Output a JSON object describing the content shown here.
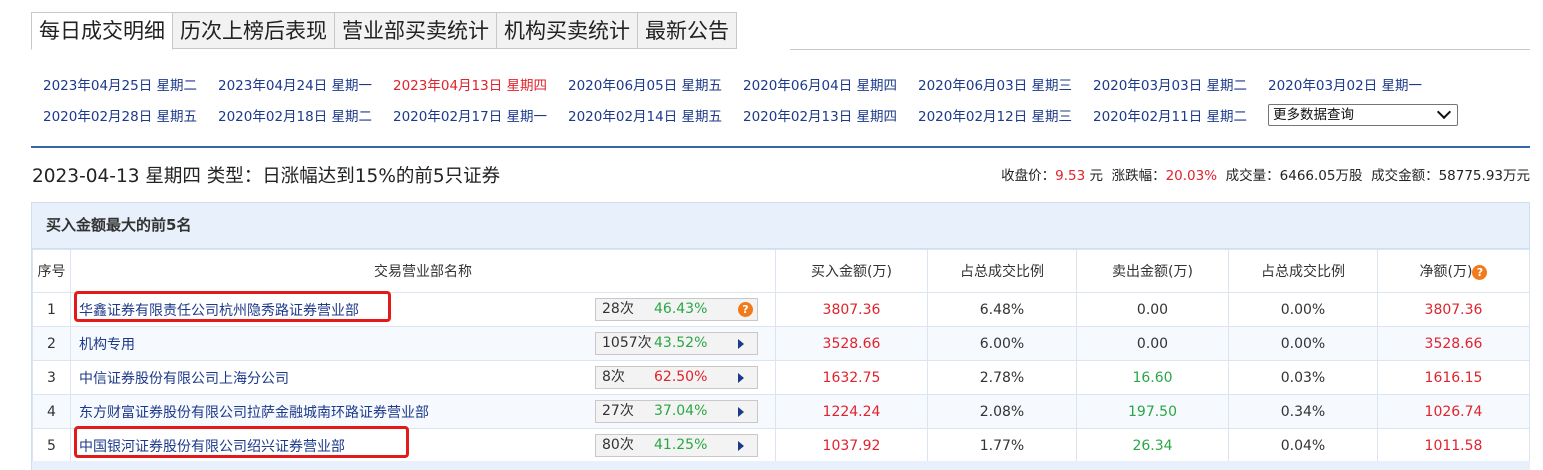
{
  "tabs": [
    {
      "label": "每日成交明细",
      "active": true
    },
    {
      "label": "历次上榜后表现",
      "active": false
    },
    {
      "label": "营业部买卖统计",
      "active": false
    },
    {
      "label": "机构买卖统计",
      "active": false
    },
    {
      "label": "最新公告",
      "active": false
    }
  ],
  "dates": [
    [
      "2023年04月25日 星期二",
      "2023年04月24日 星期一",
      "2023年04月13日 星期四",
      "2020年06月05日 星期五",
      "2020年06月04日 星期四",
      "2020年06月03日 星期三",
      "2020年03月03日 星期二",
      "2020年03月02日 星期一"
    ],
    [
      "2020年02月28日 星期五",
      "2020年02月18日 星期二",
      "2020年02月17日 星期一",
      "2020年02月14日 星期五",
      "2020年02月13日 星期四",
      "2020年02月12日 星期三",
      "2020年02月11日 星期二"
    ]
  ],
  "current_date": "2023年04月13日 星期四",
  "more_select": {
    "value": "更多数据查询"
  },
  "summary": {
    "title": "2023-04-13 星期四 类型：日涨幅达到15%的前5只证券",
    "close_label": "收盘价：",
    "close_value": "9.53",
    "close_unit": "元",
    "change_label": "涨跌幅：",
    "change_value": "20.03%",
    "volume_label": "成交量：",
    "volume_value": "6466.05万股",
    "amount_label": "成交金额：",
    "amount_value": "58775.93万元"
  },
  "table": {
    "caption": "买入金额最大的前5名",
    "headers": {
      "idx": "序号",
      "name": "交易营业部名称",
      "buy": "买入金额(万)",
      "buy_ratio": "占总成交比例",
      "sell": "卖出金额(万)",
      "sell_ratio": "占总成交比例",
      "net": "净额(万)"
    },
    "rows": [
      {
        "idx": "1",
        "name": "华鑫证券有限责任公司杭州隐秀路证券营业部",
        "count": "28次",
        "rate": "46.43%",
        "buy": "3807.36",
        "buy_ratio": "6.48%",
        "sell": "0.00",
        "sell_ratio": "0.00%",
        "net": "3807.36",
        "icon": "question-icon"
      },
      {
        "idx": "2",
        "name": "机构专用",
        "count": "1057次",
        "rate": "43.52%",
        "buy": "3528.66",
        "buy_ratio": "6.00%",
        "sell": "0.00",
        "sell_ratio": "0.00%",
        "net": "3528.66",
        "icon": "play-arrow-icon"
      },
      {
        "idx": "3",
        "name": "中信证券股份有限公司上海分公司",
        "count": "8次",
        "rate": "62.50%",
        "buy": "1632.75",
        "buy_ratio": "2.78%",
        "sell": "16.60",
        "sell_ratio": "0.03%",
        "net": "1616.15",
        "icon": "play-arrow-icon"
      },
      {
        "idx": "4",
        "name": "东方财富证券股份有限公司拉萨金融城南环路证券营业部",
        "count": "27次",
        "rate": "37.04%",
        "buy": "1224.24",
        "buy_ratio": "2.08%",
        "sell": "197.50",
        "sell_ratio": "0.34%",
        "net": "1026.74",
        "icon": "play-arrow-icon"
      },
      {
        "idx": "5",
        "name": "中国银河证券股份有限公司绍兴证券营业部",
        "count": "80次",
        "rate": "41.25%",
        "buy": "1037.92",
        "buy_ratio": "1.77%",
        "sell": "26.34",
        "sell_ratio": "0.04%",
        "net": "1011.58",
        "icon": "play-arrow-icon"
      }
    ]
  },
  "colors": {
    "link": "#1d3a8a",
    "up": "#e0232c",
    "down": "#2aa745",
    "highlight": "#e21a1a",
    "accent": "#3468a8"
  }
}
